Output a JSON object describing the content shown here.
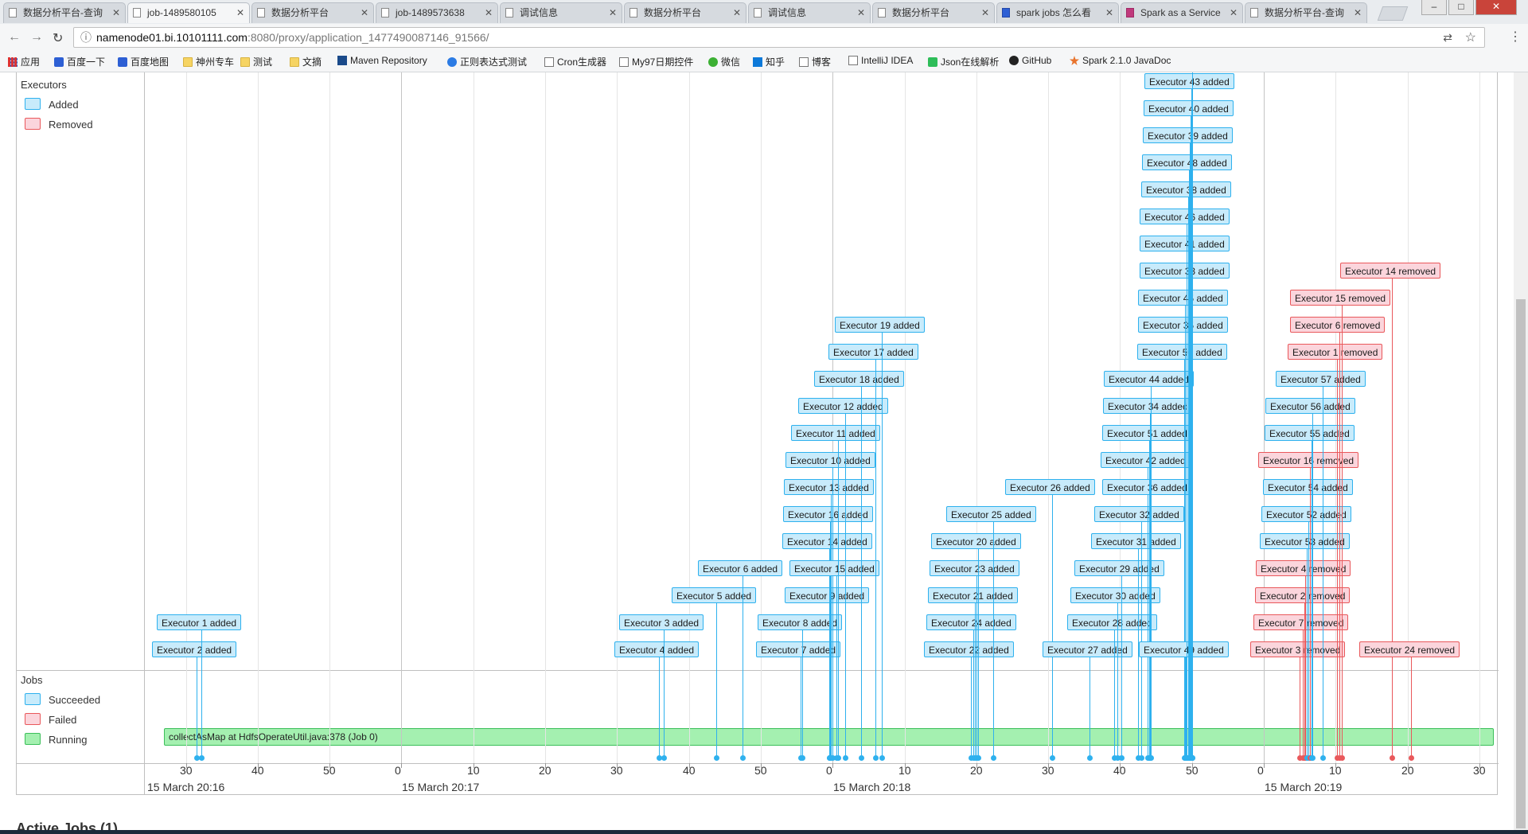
{
  "tabs": [
    {
      "title": "数据分析平台-查询",
      "active": false,
      "icon": "page"
    },
    {
      "title": "job-1489580105",
      "active": true,
      "icon": "page"
    },
    {
      "title": "数据分析平台",
      "active": false,
      "icon": "page"
    },
    {
      "title": "job-1489573638",
      "active": false,
      "icon": "page"
    },
    {
      "title": "调试信息",
      "active": false,
      "icon": "page"
    },
    {
      "title": "数据分析平台",
      "active": false,
      "icon": "page"
    },
    {
      "title": "调试信息",
      "active": false,
      "icon": "page"
    },
    {
      "title": "数据分析平台",
      "active": false,
      "icon": "page"
    },
    {
      "title": "spark jobs 怎么看",
      "active": false,
      "icon": "baidu"
    },
    {
      "title": "Spark as a Service",
      "active": false,
      "icon": "spark"
    },
    {
      "title": "数据分析平台-查询",
      "active": false,
      "icon": "page"
    }
  ],
  "window_controls": [
    "minimize",
    "maximize",
    "close"
  ],
  "url": {
    "host": "namenode01.bi.10101111.com",
    "path": ":8080/proxy/application_1477490087146_91566/"
  },
  "bookmarks": [
    {
      "label": "应用",
      "icon": "grid"
    },
    {
      "label": "百度一下",
      "icon": "paw"
    },
    {
      "label": "百度地图",
      "icon": "paw"
    },
    {
      "label": "神州专车",
      "icon": "folder"
    },
    {
      "label": "测试",
      "icon": "folder"
    },
    {
      "label": "文摘",
      "icon": "folder"
    },
    {
      "label": "Maven Repository",
      "icon": "mvn"
    },
    {
      "label": "正则表达式测试",
      "icon": "regex"
    },
    {
      "label": "Cron生成器",
      "icon": "page"
    },
    {
      "label": "My97日期控件",
      "icon": "page"
    },
    {
      "label": "微信",
      "icon": "wx"
    },
    {
      "label": "知乎",
      "icon": "zh"
    },
    {
      "label": "博客",
      "icon": "page"
    },
    {
      "label": "IntelliJ IDEA",
      "icon": "page"
    },
    {
      "label": "Json在线解析",
      "icon": "json"
    },
    {
      "label": "GitHub",
      "icon": "gh"
    },
    {
      "label": "Spark 2.1.0 JavaDoc",
      "icon": "spk"
    }
  ],
  "timeline": {
    "groups": {
      "executors": "Executors",
      "jobs": "Jobs"
    },
    "executor_legend": [
      {
        "label": "Added",
        "color": "#c8ebfb",
        "border": "#2eb1ee"
      },
      {
        "label": "Removed",
        "color": "#fbd5dc",
        "border": "#e9585b"
      }
    ],
    "job_legend": [
      {
        "label": "Succeeded",
        "color": "#c8ebfb",
        "border": "#2eb1ee"
      },
      {
        "label": "Failed",
        "color": "#fbd5dc",
        "border": "#e9585b"
      },
      {
        "label": "Running",
        "color": "#a4f0b0",
        "border": "#3cbf5a"
      }
    ],
    "ticks": [
      {
        "label": "30",
        "t": 30
      },
      {
        "label": "40",
        "t": 40
      },
      {
        "label": "50",
        "t": 50
      },
      {
        "label": "0",
        "t": 60
      },
      {
        "label": "10",
        "t": 70
      },
      {
        "label": "20",
        "t": 80
      },
      {
        "label": "30",
        "t": 90
      },
      {
        "label": "40",
        "t": 100
      },
      {
        "label": "50",
        "t": 110
      },
      {
        "label": "0",
        "t": 120
      },
      {
        "label": "10",
        "t": 130
      },
      {
        "label": "20",
        "t": 140
      },
      {
        "label": "30",
        "t": 150
      },
      {
        "label": "40",
        "t": 160
      },
      {
        "label": "50",
        "t": 170
      },
      {
        "label": "0",
        "t": 180
      },
      {
        "label": "10",
        "t": 190
      },
      {
        "label": "20",
        "t": 200
      },
      {
        "label": "30",
        "t": 210
      }
    ],
    "major_labels": [
      {
        "label": "15 March 20:16",
        "t": 25
      },
      {
        "label": "15 March 20:17",
        "t": 60
      },
      {
        "label": "15 March 20:18",
        "t": 120
      },
      {
        "label": "15 March 20:19",
        "t": 180
      }
    ],
    "events": [
      {
        "label": "Executor 1 added",
        "type": "added",
        "t": 32.2
      },
      {
        "label": "Executor 2 added",
        "type": "added",
        "t": 31.5
      },
      {
        "label": "Executor 3 added",
        "type": "added",
        "t": 96.5
      },
      {
        "label": "Executor 4 added",
        "type": "added",
        "t": 95.8
      },
      {
        "label": "Executor 5 added",
        "type": "added",
        "t": 103.8
      },
      {
        "label": "Executor 6 added",
        "type": "added",
        "t": 107.5
      },
      {
        "label": "Executor 7 added",
        "type": "added",
        "t": 115.6
      },
      {
        "label": "Executor 8 added",
        "type": "added",
        "t": 115.8
      },
      {
        "label": "Executor 9 added",
        "type": "added",
        "t": 119.5
      },
      {
        "label": "Executor 10 added",
        "type": "added",
        "t": 120.0
      },
      {
        "label": "Executor 11 added",
        "type": "added",
        "t": 120.8
      },
      {
        "label": "Executor 12 added",
        "type": "added",
        "t": 121.8
      },
      {
        "label": "Executor 13 added",
        "type": "added",
        "t": 119.8
      },
      {
        "label": "Executor 14 added",
        "type": "added",
        "t": 119.5
      },
      {
        "label": "Executor 15 added",
        "type": "added",
        "t": 120.5
      },
      {
        "label": "Executor 16 added",
        "type": "added",
        "t": 119.6
      },
      {
        "label": "Executor 17 added",
        "type": "added",
        "t": 126.0
      },
      {
        "label": "Executor 18 added",
        "type": "added",
        "t": 124.0
      },
      {
        "label": "Executor 19 added",
        "type": "added",
        "t": 126.8
      },
      {
        "label": "Executor 20 added",
        "type": "added",
        "t": 140.2
      },
      {
        "label": "Executor 21 added",
        "type": "added",
        "t": 139.8
      },
      {
        "label": "Executor 22 added",
        "type": "added",
        "t": 139.2
      },
      {
        "label": "Executor 23 added",
        "type": "added",
        "t": 140.0
      },
      {
        "label": "Executor 24 added",
        "type": "added",
        "t": 139.6
      },
      {
        "label": "Executor 25 added",
        "type": "added",
        "t": 142.4
      },
      {
        "label": "Executor 26 added",
        "type": "added",
        "t": 150.5
      },
      {
        "label": "Executor 27 added",
        "type": "added",
        "t": 155.7
      },
      {
        "label": "Executor 28 added",
        "type": "added",
        "t": 159.2
      },
      {
        "label": "Executor 29 added",
        "type": "added",
        "t": 160.2
      },
      {
        "label": "Executor 30 added",
        "type": "added",
        "t": 159.6
      },
      {
        "label": "Executor 31 added",
        "type": "added",
        "t": 162.5
      },
      {
        "label": "Executor 32 added",
        "type": "added",
        "t": 163.0
      },
      {
        "label": "Executor 33 added",
        "type": "added",
        "t": 169.3
      },
      {
        "label": "Executor 34 added",
        "type": "added",
        "t": 164.2
      },
      {
        "label": "Executor 35 added",
        "type": "added",
        "t": 169.0
      },
      {
        "label": "Executor 36 added",
        "type": "added",
        "t": 164.0
      },
      {
        "label": "Executor 37 added",
        "type": "added",
        "t": 170.0
      },
      {
        "label": "Executor 38 added",
        "type": "added",
        "t": 169.5
      },
      {
        "label": "Executor 39 added",
        "type": "added",
        "t": 169.7
      },
      {
        "label": "Executor 40 added",
        "type": "added",
        "t": 169.8
      },
      {
        "label": "Executor 41 added",
        "type": "added",
        "t": 169.3
      },
      {
        "label": "Executor 42 added",
        "type": "added",
        "t": 163.8
      },
      {
        "label": "Executor 43 added",
        "type": "added",
        "t": 169.9
      },
      {
        "label": "Executor 44 added",
        "type": "added",
        "t": 164.3
      },
      {
        "label": "Executor 45 added",
        "type": "added",
        "t": 169.0
      },
      {
        "label": "Executor 46 added",
        "type": "added",
        "t": 169.3
      },
      {
        "label": "Executor 47 added",
        "type": "added",
        "t": 170.0
      },
      {
        "label": "Executor 48 added",
        "type": "added",
        "t": 169.6
      },
      {
        "label": "Executor 49 added",
        "type": "added",
        "t": 169.2
      },
      {
        "label": "Executor 50 added",
        "type": "added",
        "t": 168.9
      },
      {
        "label": "Executor 51 added",
        "type": "added",
        "t": 164.1
      },
      {
        "label": "Executor 52 added",
        "type": "added",
        "t": 186.2
      },
      {
        "label": "Executor 53 added",
        "type": "added",
        "t": 186.0
      },
      {
        "label": "Executor 54 added",
        "type": "added",
        "t": 186.4
      },
      {
        "label": "Executor 55 added",
        "type": "added",
        "t": 186.6
      },
      {
        "label": "Executor 56 added",
        "type": "added",
        "t": 186.8
      },
      {
        "label": "Executor 57 added",
        "type": "added",
        "t": 188.2
      },
      {
        "label": "Executor 1 removed",
        "type": "removed",
        "t": 190.2
      },
      {
        "label": "Executor 2 removed",
        "type": "removed",
        "t": 185.6
      },
      {
        "label": "Executor 3 removed",
        "type": "removed",
        "t": 185.0
      },
      {
        "label": "Executor 4 removed",
        "type": "removed",
        "t": 185.8
      },
      {
        "label": "Executor 6 removed",
        "type": "removed",
        "t": 190.5
      },
      {
        "label": "Executor 7 removed",
        "type": "removed",
        "t": 185.4
      },
      {
        "label": "Executor 14 removed",
        "type": "removed",
        "t": 197.8
      },
      {
        "label": "Executor 15 removed",
        "type": "removed",
        "t": 190.8
      },
      {
        "label": "Executor 16 removed",
        "type": "removed",
        "t": 186.4
      },
      {
        "label": "Executor 24 removed",
        "type": "removed",
        "t": 200.5
      }
    ],
    "job": {
      "label": "collectAsMap at HdfsOperateUtil.java:378 (Job 0)",
      "start": 27,
      "end": 212,
      "status": "Running"
    }
  },
  "section_heading": "Active Jobs (1)"
}
